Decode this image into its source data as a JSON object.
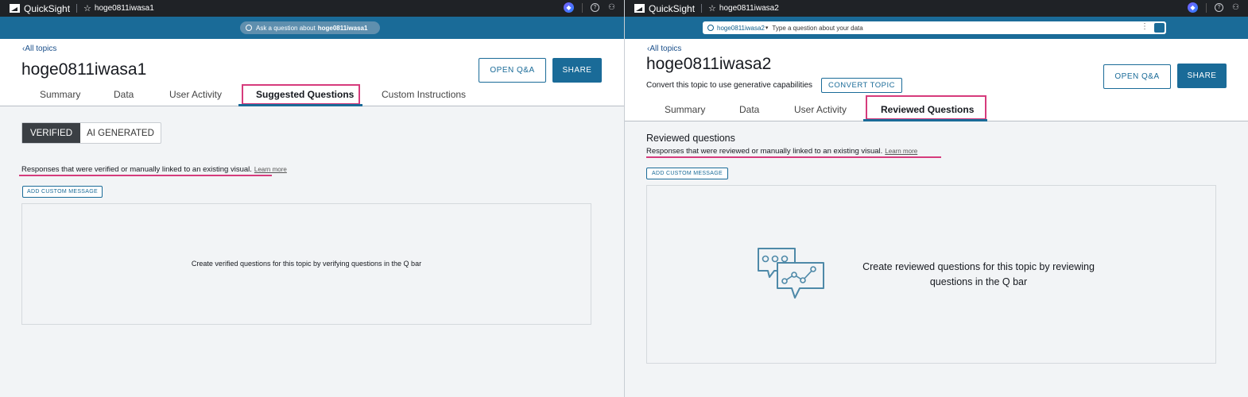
{
  "left": {
    "app_name": "QuickSight",
    "topic_name_top": "hoge0811iwasa1",
    "ask_prefix": "Ask a question about",
    "ask_topic": "hoge0811iwasa1",
    "all_topics": "All topics",
    "title": "hoge0811iwasa1",
    "open_qa": "OPEN Q&A",
    "share": "SHARE",
    "tabs": [
      "Summary",
      "Data",
      "User Activity",
      "Suggested Questions",
      "Custom Instructions"
    ],
    "segments": [
      "VERIFIED",
      "AI GENERATED"
    ],
    "description": "Responses that were verified or manually linked to an existing visual.",
    "learn_more": "Learn more",
    "add_custom_message": "ADD CUSTOM MESSAGE",
    "empty_message": "Create verified questions for this topic by verifying questions in the Q bar"
  },
  "right": {
    "app_name": "QuickSight",
    "topic_name_top": "hoge0811iwasa2",
    "qbar_topic": "hoge0811iwasa2",
    "qbar_placeholder": "Type a question about your data",
    "all_topics": "All topics",
    "title": "hoge0811iwasa2",
    "convert_text": "Convert this topic to use generative capabilities",
    "convert_button": "CONVERT TOPIC",
    "open_qa": "OPEN Q&A",
    "share": "SHARE",
    "tabs": [
      "Summary",
      "Data",
      "User Activity",
      "Reviewed Questions"
    ],
    "subheading": "Reviewed questions",
    "description": "Responses that were reviewed or manually linked to an existing visual.",
    "learn_more": "Learn more",
    "add_custom_message": "ADD CUSTOM MESSAGE",
    "empty_message_line1": "Create reviewed questions for this topic by reviewing",
    "empty_message_line2": "questions in the Q bar"
  },
  "colors": {
    "topbar": "#1f2226",
    "blue_bar": "#1a6b98",
    "accent": "#1a6b98",
    "highlight": "#d63b7c"
  },
  "icons": [
    "quicksight-logo-icon",
    "star-icon",
    "q-assistant-icon",
    "help-icon",
    "user-icon",
    "search-icon",
    "chevron-left-icon",
    "chat-bubbles-icon"
  ]
}
